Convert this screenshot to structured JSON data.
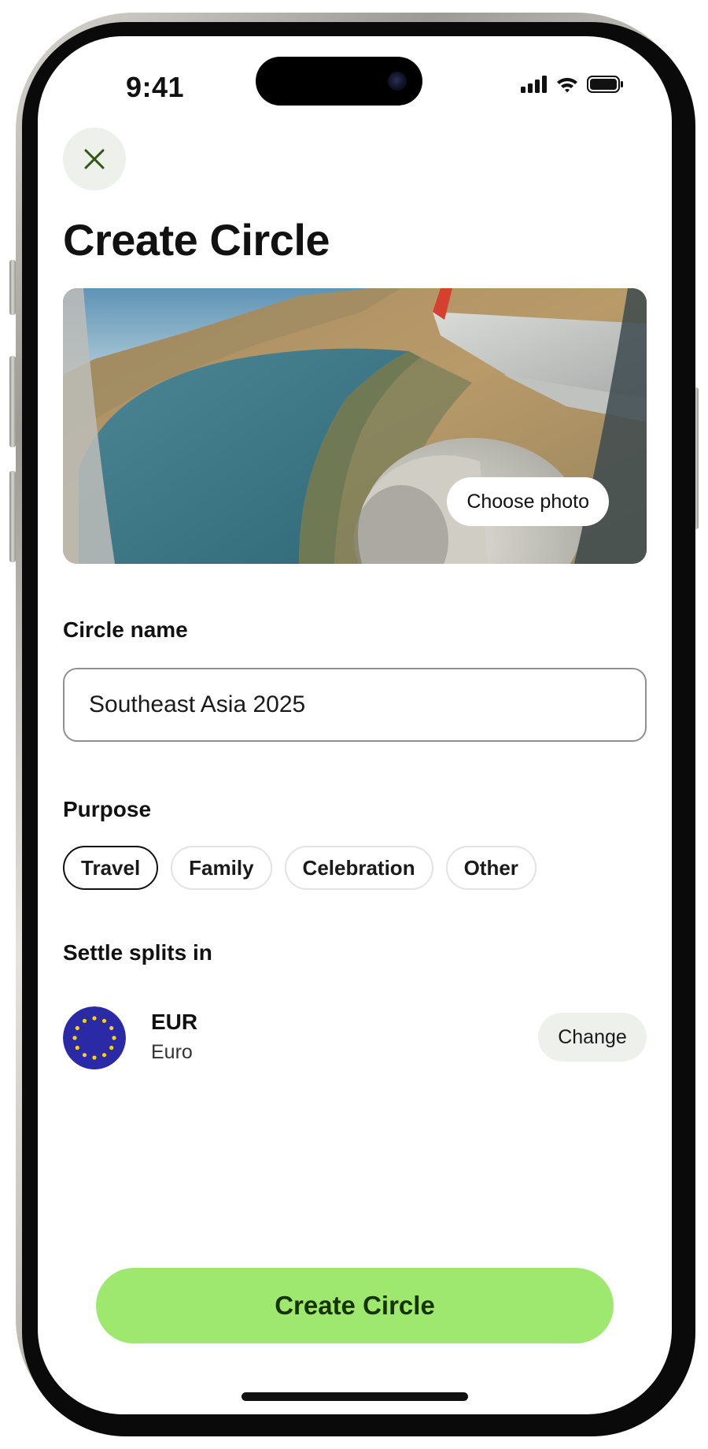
{
  "status_bar": {
    "time": "9:41",
    "icons": [
      "signal-icon",
      "wifi-icon",
      "battery-icon"
    ]
  },
  "header": {
    "close_icon": "close-icon",
    "title": "Create Circle"
  },
  "cover": {
    "choose_photo_label": "Choose photo",
    "image_subject": "airplane-window-view"
  },
  "form": {
    "name_label": "Circle name",
    "name_value": "Southeast Asia 2025",
    "purpose_label": "Purpose",
    "purpose_options": [
      {
        "label": "Travel",
        "selected": true
      },
      {
        "label": "Family",
        "selected": false
      },
      {
        "label": "Celebration",
        "selected": false
      },
      {
        "label": "Other",
        "selected": false
      }
    ],
    "settle_label": "Settle splits in",
    "currency": {
      "code": "EUR",
      "name": "Euro",
      "flag_icon": "eu-flag-icon",
      "change_label": "Change"
    }
  },
  "actions": {
    "create_label": "Create Circle"
  },
  "colors": {
    "primary_button": "#9fe870",
    "primary_button_text": "#163300",
    "secondary_button": "#eef0ec",
    "close_icon": "#2f5711",
    "eu_blue": "#2b2aa6",
    "eu_star": "#ffd400"
  }
}
